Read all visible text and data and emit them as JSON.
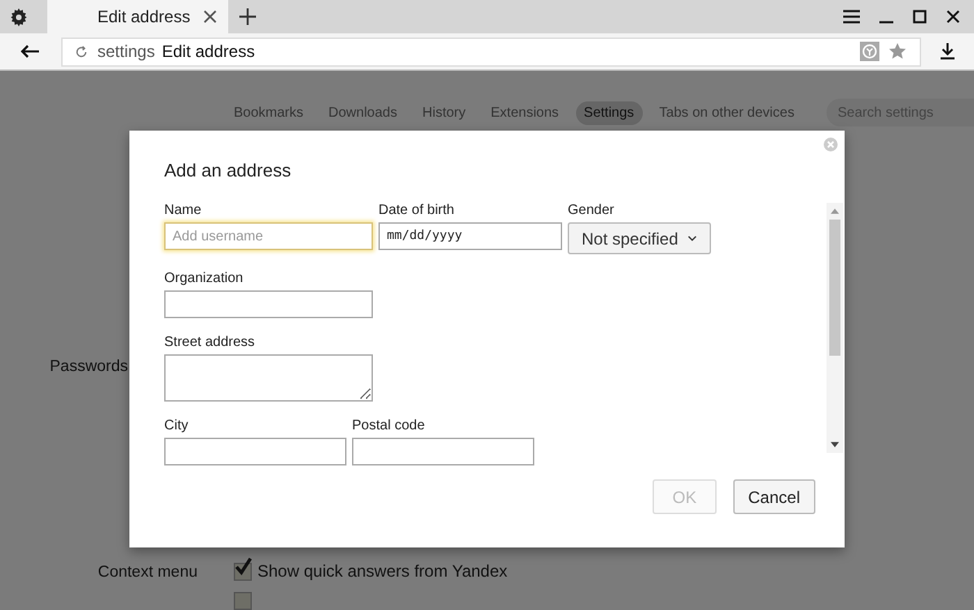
{
  "browser": {
    "tab": {
      "title": "Edit address"
    },
    "address": {
      "prefix": "settings",
      "title": "Edit address"
    }
  },
  "settings_nav": {
    "items": [
      {
        "label": "Bookmarks",
        "selected": false
      },
      {
        "label": "Downloads",
        "selected": false
      },
      {
        "label": "History",
        "selected": false
      },
      {
        "label": "Extensions",
        "selected": false
      },
      {
        "label": "Settings",
        "selected": true
      },
      {
        "label": "Tabs on other devices",
        "selected": false
      }
    ],
    "search": {
      "placeholder": "Search settings"
    }
  },
  "sections": [
    {
      "label": "Passwords"
    },
    {
      "label": "Context menu",
      "options": [
        {
          "label": "Show quick answers from Yandex",
          "checked": true
        },
        {
          "checked": false
        }
      ]
    }
  ],
  "dialog": {
    "title": "Add an address",
    "fields": [
      {
        "label": "Name",
        "kind": "text",
        "placeholder": "Add username",
        "focused": true
      },
      {
        "label": "Date of birth",
        "kind": "date",
        "value": "mm/dd/yyyy",
        "focused": false
      },
      {
        "label": "Gender",
        "kind": "select",
        "value": "Not specified",
        "focused": false
      },
      {
        "label": "Organization",
        "kind": "text",
        "focused": false
      },
      {
        "label": "Street address",
        "kind": "textarea",
        "focused": false
      },
      {
        "label": "City",
        "kind": "text",
        "focused": false
      },
      {
        "label": "Postal code",
        "kind": "text",
        "focused": false
      }
    ],
    "buttons": [
      {
        "label": "OK",
        "disabled": true
      },
      {
        "label": "Cancel",
        "disabled": false
      }
    ]
  }
}
